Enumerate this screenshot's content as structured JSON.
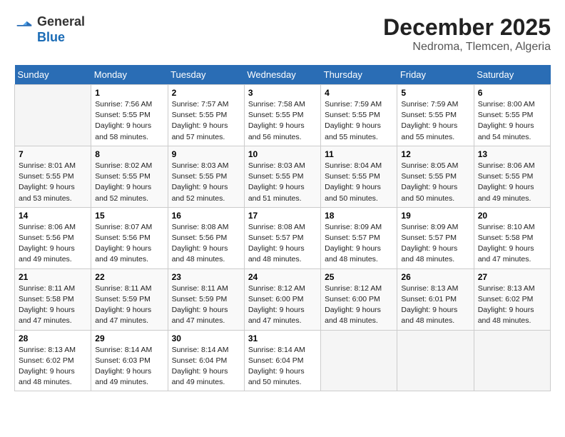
{
  "header": {
    "logo_general": "General",
    "logo_blue": "Blue",
    "month_year": "December 2025",
    "location": "Nedroma, Tlemcen, Algeria"
  },
  "calendar": {
    "days_of_week": [
      "Sunday",
      "Monday",
      "Tuesday",
      "Wednesday",
      "Thursday",
      "Friday",
      "Saturday"
    ],
    "weeks": [
      [
        {
          "day": null,
          "info": null
        },
        {
          "day": "1",
          "info": "Sunrise: 7:56 AM\nSunset: 5:55 PM\nDaylight: 9 hours\nand 58 minutes."
        },
        {
          "day": "2",
          "info": "Sunrise: 7:57 AM\nSunset: 5:55 PM\nDaylight: 9 hours\nand 57 minutes."
        },
        {
          "day": "3",
          "info": "Sunrise: 7:58 AM\nSunset: 5:55 PM\nDaylight: 9 hours\nand 56 minutes."
        },
        {
          "day": "4",
          "info": "Sunrise: 7:59 AM\nSunset: 5:55 PM\nDaylight: 9 hours\nand 55 minutes."
        },
        {
          "day": "5",
          "info": "Sunrise: 7:59 AM\nSunset: 5:55 PM\nDaylight: 9 hours\nand 55 minutes."
        },
        {
          "day": "6",
          "info": "Sunrise: 8:00 AM\nSunset: 5:55 PM\nDaylight: 9 hours\nand 54 minutes."
        }
      ],
      [
        {
          "day": "7",
          "info": "Sunrise: 8:01 AM\nSunset: 5:55 PM\nDaylight: 9 hours\nand 53 minutes."
        },
        {
          "day": "8",
          "info": "Sunrise: 8:02 AM\nSunset: 5:55 PM\nDaylight: 9 hours\nand 52 minutes."
        },
        {
          "day": "9",
          "info": "Sunrise: 8:03 AM\nSunset: 5:55 PM\nDaylight: 9 hours\nand 52 minutes."
        },
        {
          "day": "10",
          "info": "Sunrise: 8:03 AM\nSunset: 5:55 PM\nDaylight: 9 hours\nand 51 minutes."
        },
        {
          "day": "11",
          "info": "Sunrise: 8:04 AM\nSunset: 5:55 PM\nDaylight: 9 hours\nand 50 minutes."
        },
        {
          "day": "12",
          "info": "Sunrise: 8:05 AM\nSunset: 5:55 PM\nDaylight: 9 hours\nand 50 minutes."
        },
        {
          "day": "13",
          "info": "Sunrise: 8:06 AM\nSunset: 5:55 PM\nDaylight: 9 hours\nand 49 minutes."
        }
      ],
      [
        {
          "day": "14",
          "info": "Sunrise: 8:06 AM\nSunset: 5:56 PM\nDaylight: 9 hours\nand 49 minutes."
        },
        {
          "day": "15",
          "info": "Sunrise: 8:07 AM\nSunset: 5:56 PM\nDaylight: 9 hours\nand 49 minutes."
        },
        {
          "day": "16",
          "info": "Sunrise: 8:08 AM\nSunset: 5:56 PM\nDaylight: 9 hours\nand 48 minutes."
        },
        {
          "day": "17",
          "info": "Sunrise: 8:08 AM\nSunset: 5:57 PM\nDaylight: 9 hours\nand 48 minutes."
        },
        {
          "day": "18",
          "info": "Sunrise: 8:09 AM\nSunset: 5:57 PM\nDaylight: 9 hours\nand 48 minutes."
        },
        {
          "day": "19",
          "info": "Sunrise: 8:09 AM\nSunset: 5:57 PM\nDaylight: 9 hours\nand 48 minutes."
        },
        {
          "day": "20",
          "info": "Sunrise: 8:10 AM\nSunset: 5:58 PM\nDaylight: 9 hours\nand 47 minutes."
        }
      ],
      [
        {
          "day": "21",
          "info": "Sunrise: 8:11 AM\nSunset: 5:58 PM\nDaylight: 9 hours\nand 47 minutes."
        },
        {
          "day": "22",
          "info": "Sunrise: 8:11 AM\nSunset: 5:59 PM\nDaylight: 9 hours\nand 47 minutes."
        },
        {
          "day": "23",
          "info": "Sunrise: 8:11 AM\nSunset: 5:59 PM\nDaylight: 9 hours\nand 47 minutes."
        },
        {
          "day": "24",
          "info": "Sunrise: 8:12 AM\nSunset: 6:00 PM\nDaylight: 9 hours\nand 47 minutes."
        },
        {
          "day": "25",
          "info": "Sunrise: 8:12 AM\nSunset: 6:00 PM\nDaylight: 9 hours\nand 48 minutes."
        },
        {
          "day": "26",
          "info": "Sunrise: 8:13 AM\nSunset: 6:01 PM\nDaylight: 9 hours\nand 48 minutes."
        },
        {
          "day": "27",
          "info": "Sunrise: 8:13 AM\nSunset: 6:02 PM\nDaylight: 9 hours\nand 48 minutes."
        }
      ],
      [
        {
          "day": "28",
          "info": "Sunrise: 8:13 AM\nSunset: 6:02 PM\nDaylight: 9 hours\nand 48 minutes."
        },
        {
          "day": "29",
          "info": "Sunrise: 8:14 AM\nSunset: 6:03 PM\nDaylight: 9 hours\nand 49 minutes."
        },
        {
          "day": "30",
          "info": "Sunrise: 8:14 AM\nSunset: 6:04 PM\nDaylight: 9 hours\nand 49 minutes."
        },
        {
          "day": "31",
          "info": "Sunrise: 8:14 AM\nSunset: 6:04 PM\nDaylight: 9 hours\nand 50 minutes."
        },
        {
          "day": null,
          "info": null
        },
        {
          "day": null,
          "info": null
        },
        {
          "day": null,
          "info": null
        }
      ]
    ]
  }
}
